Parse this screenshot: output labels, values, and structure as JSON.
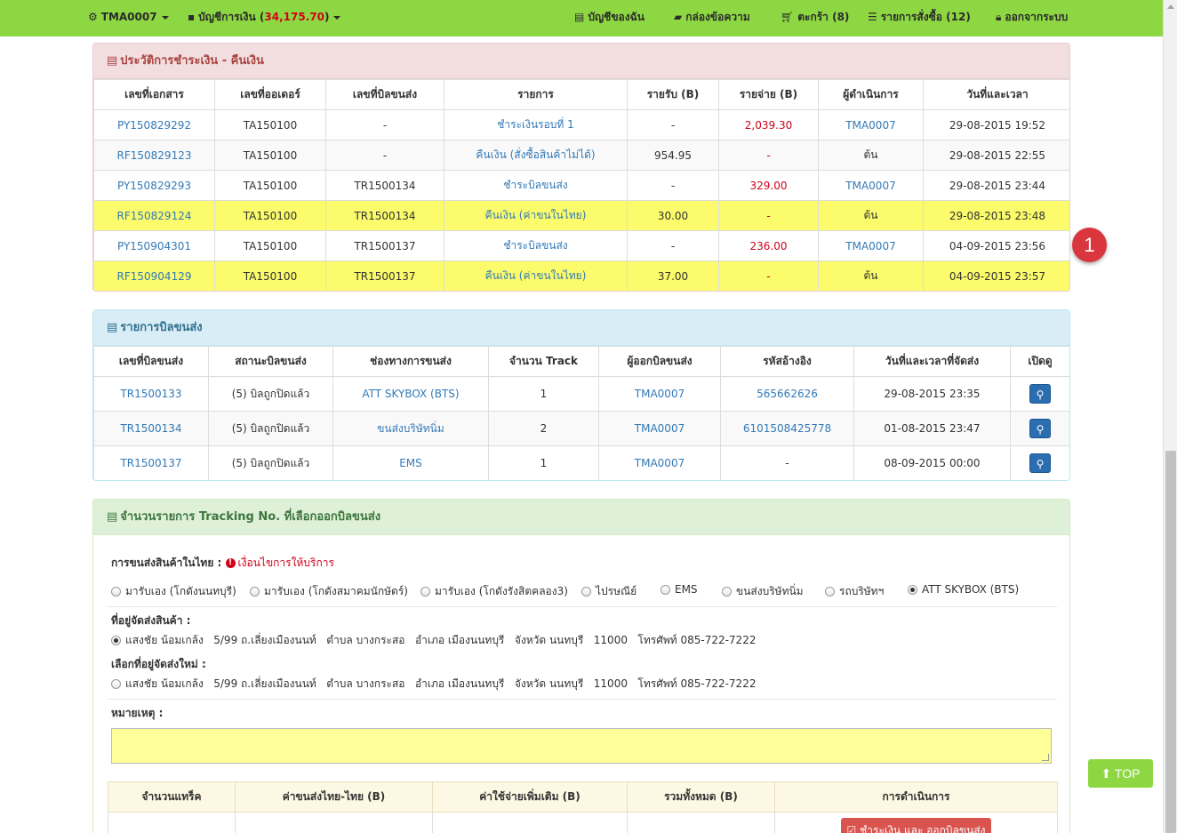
{
  "nav": {
    "user": "TMA0007",
    "account_prefix": "บัญชีการเงิน (",
    "account_balance": "34,175.70",
    "account_suffix": ")",
    "my_account": "บัญชีของฉัน",
    "inbox": "กล่องข้อความ",
    "cart": "ตะกร้า (8)",
    "orders": "รายการสั่งซื้อ (12)",
    "logout": "ออกจากระบบ"
  },
  "payment_history": {
    "title": "ประวัติการชำระเงิน - คืนเงิน",
    "columns": [
      "เลขที่เอกสาร",
      "เลขที่ออเดอร์",
      "เลขที่บิลขนส่ง",
      "รายการ",
      "รายรับ (B)",
      "รายจ่าย (B)",
      "ผู้ดำเนินการ",
      "วันที่และเวลา"
    ],
    "rows": [
      {
        "doc": "PY150829292",
        "order": "TA150100",
        "bill": "-",
        "item": "ชำระเงินรอบที่ 1",
        "income": "-",
        "expense": "2,039.30",
        "operator": "TMA0007",
        "datetime": "29-08-2015 19:52",
        "highlight": false
      },
      {
        "doc": "RF150829123",
        "order": "TA150100",
        "bill": "-",
        "item": "คืนเงิน (สั่งซื้อสินค้าไม่ได้)",
        "income": "954.95",
        "expense": "-",
        "operator": "ต้น",
        "datetime": "29-08-2015 22:55",
        "highlight": false
      },
      {
        "doc": "PY150829293",
        "order": "TA150100",
        "bill": "TR1500134",
        "item": "ชำระบิลขนส่ง",
        "income": "-",
        "expense": "329.00",
        "operator": "TMA0007",
        "datetime": "29-08-2015 23:44",
        "highlight": false
      },
      {
        "doc": "RF150829124",
        "order": "TA150100",
        "bill": "TR1500134",
        "item": "คืนเงิน (ค่าขนในไทย)",
        "income": "30.00",
        "expense": "-",
        "operator": "ต้น",
        "datetime": "29-08-2015 23:48",
        "highlight": true
      },
      {
        "doc": "PY150904301",
        "order": "TA150100",
        "bill": "TR1500137",
        "item": "ชำระบิลขนส่ง",
        "income": "-",
        "expense": "236.00",
        "operator": "TMA0007",
        "datetime": "04-09-2015 23:56",
        "highlight": false
      },
      {
        "doc": "RF150904129",
        "order": "TA150100",
        "bill": "TR1500137",
        "item": "คืนเงิน (ค่าขนในไทย)",
        "income": "37.00",
        "expense": "-",
        "operator": "ต้น",
        "datetime": "04-09-2015 23:57",
        "highlight": true
      }
    ],
    "annotation_badge": "1"
  },
  "shipping_bills": {
    "title": "รายการบิลขนส่ง",
    "columns": [
      "เลขที่บิลขนส่ง",
      "สถานะบิลขนส่ง",
      "ช่องทางการขนส่ง",
      "จำนวน Track",
      "ผู้ออกบิลขนส่ง",
      "รหัสอ้างอิง",
      "วันที่และเวลาที่จัดส่ง",
      "เปิดดู"
    ],
    "rows": [
      {
        "bill": "TR1500133",
        "status": "(5) บิลถูกปิดแล้ว",
        "channel": "ATT SKYBOX (BTS)",
        "tracks": "1",
        "issuer": "TMA0007",
        "ref": "565662626",
        "datetime": "29-08-2015 23:35"
      },
      {
        "bill": "TR1500134",
        "status": "(5) บิลถูกปิดแล้ว",
        "channel": "ขนส่งบริษัทนิ่ม",
        "tracks": "2",
        "issuer": "TMA0007",
        "ref": "6101508425778",
        "datetime": "01-08-2015 23:47"
      },
      {
        "bill": "TR1500137",
        "status": "(5) บิลถูกปิดแล้ว",
        "channel": "EMS",
        "tracks": "1",
        "issuer": "TMA0007",
        "ref": "-",
        "datetime": "08-09-2015 00:00"
      }
    ]
  },
  "tracking": {
    "title": "จำนวนรายการ Tracking No. ที่เลือกออกบิลขนส่ง",
    "shipping_label": "การขนส่งสินค้าในไทย :",
    "conditions_link": "เงื่อนไขการให้บริการ",
    "options": [
      "มารับเอง (โกดังนนทบุรี)",
      "มารับเอง (โกดังสมาคมนักษัตร์)",
      "มารับเอง (โกดังรังสิตคลอง3)",
      "ไปรษณีย์",
      "EMS",
      "ขนส่งบริษัทนิ่ม",
      "รถบริษัทฯ",
      "ATT SKYBOX (BTS)"
    ],
    "selected_option": "ATT SKYBOX (BTS)",
    "address_label": "ที่อยู่จัดส่งสินค้า :",
    "address": "แสงชัย น้อมเกล้ง   5/99 ถ.เลี่ยงเมืองนนท์   ตำบล บางกระสอ   อำเภอ เมืองนนทบุรี   จังหวัด นนทบุรี   11000   โทรศัพท์ 085-722-7222",
    "new_address_label": "เลือกที่อยู่จัดส่งใหม่ :",
    "new_address": "แสงชัย น้อมเกล้ง   5/99 ถ.เลี่ยงเมืองนนท์   ตำบล บางกระสอ   อำเภอ เมืองนนทบุรี   จังหวัด นนทบุรี   11000   โทรศัพท์ 085-722-7222",
    "remark_label": "หมายเหตุ :",
    "summary_columns": [
      "จำนวนแทร็ค",
      "ค่าขนส่งไทย-ไทย (B)",
      "ค่าใช้จ่ายเพิ่มเติม (B)",
      "รวมทั้งหมด (B)",
      "การดำเนินการ"
    ],
    "pay_button": "ชำระเงิน และ ออกบิลขนส่ง"
  },
  "top_button": "TOP",
  "colors": {
    "nav_bg": "#8dd742",
    "highlight": "#fbfb6b",
    "badge": "#d9363e"
  }
}
